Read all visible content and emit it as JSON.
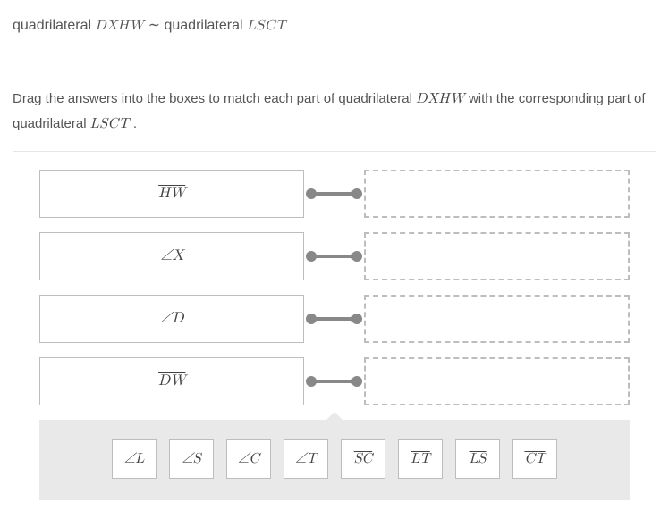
{
  "heading": {
    "prefix": "quadrilateral ",
    "shape1": "DXHW",
    "tilde": " ∼ ",
    "prefix2": "quadrilateral ",
    "shape2": "LSCT"
  },
  "instructions": {
    "t1": "Drag the answers into the boxes to match each part of ",
    "strong1a": "quadrilateral ",
    "strong1b": "DXHW",
    "t2": " with the corresponding part of ",
    "strong2a": "quadrilateral ",
    "strong2b": "LSCT",
    "t3": " ."
  },
  "rows": [
    {
      "label": "HW",
      "overline": true
    },
    {
      "label": "∠X",
      "overline": false
    },
    {
      "label": "∠D",
      "overline": false
    },
    {
      "label": "DW",
      "overline": true
    }
  ],
  "chips": [
    {
      "text": "∠L",
      "overline": false
    },
    {
      "text": "∠S",
      "overline": false
    },
    {
      "text": "∠C",
      "overline": false
    },
    {
      "text": "∠T",
      "overline": false
    },
    {
      "text": "SC",
      "overline": true
    },
    {
      "text": "LT",
      "overline": true
    },
    {
      "text": "LS",
      "overline": true
    },
    {
      "text": "CT",
      "overline": true
    }
  ]
}
